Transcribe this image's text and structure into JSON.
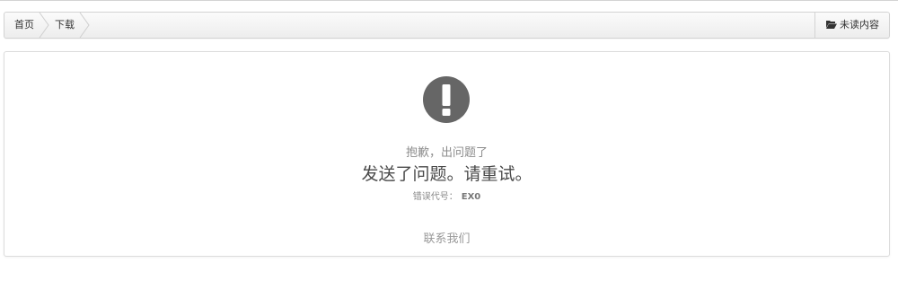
{
  "breadcrumb": {
    "items": [
      {
        "label": "首页"
      },
      {
        "label": "下载"
      }
    ],
    "unread_label": "未读内容"
  },
  "error": {
    "icon": "exclamation-circle-icon",
    "sorry_text": "抱歉，出问题了",
    "message": "发送了问题。请重试。",
    "code_label": "错误代号：",
    "code_value": "EX0",
    "contact_label": "联系我们"
  },
  "colors": {
    "icon": "#666666",
    "border": "#d3d3d3"
  }
}
